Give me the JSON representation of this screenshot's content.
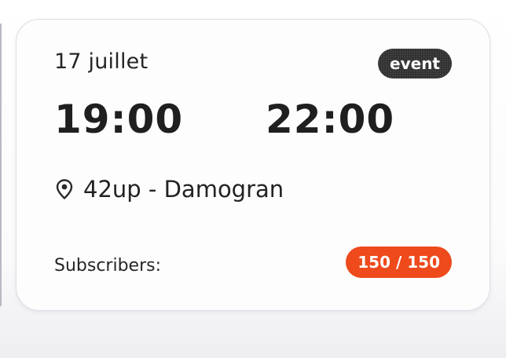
{
  "event": {
    "date": "17 juillet",
    "tag": "event",
    "start_time": "19:00",
    "end_time": "22:00",
    "location": "42up - Damogran",
    "subscribers_label": "Subscribers:",
    "subscribers_count": "150 / 150",
    "location_icon": "map-pin-icon"
  },
  "colors": {
    "tag_background": "#2a2a2a",
    "count_badge_background": "#ee4a1c",
    "text_primary": "#1f1f1f"
  }
}
